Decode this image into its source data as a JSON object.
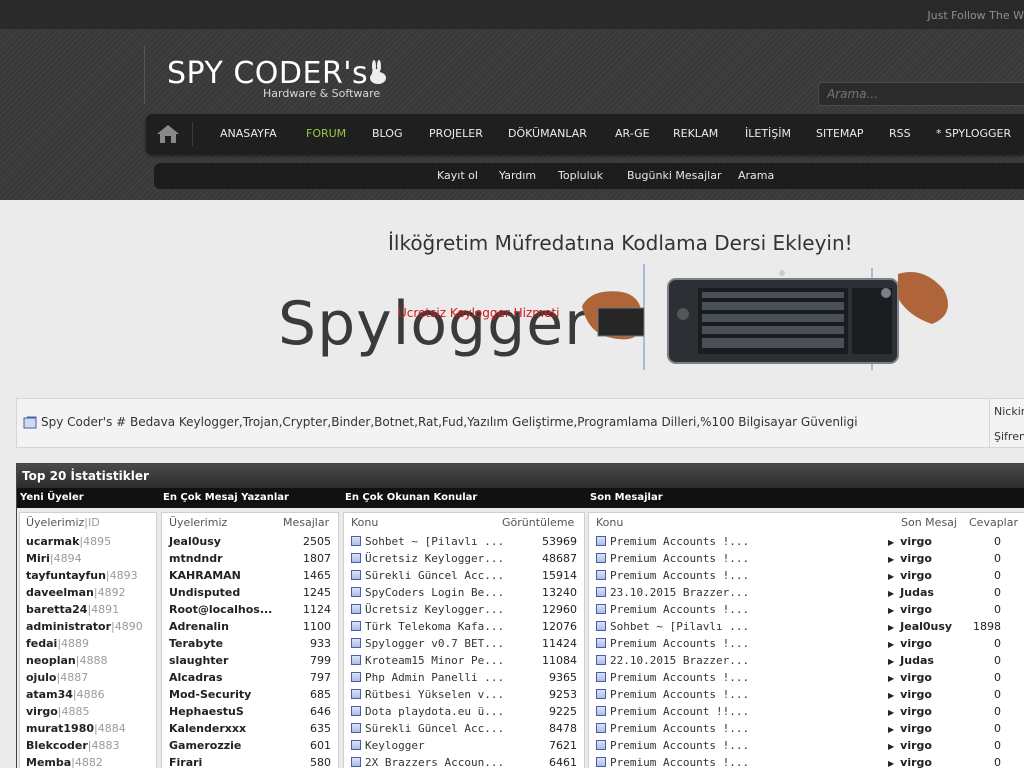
{
  "topbar": {
    "tagline": "Just Follow The W"
  },
  "logo": {
    "title": "SPY CODER's",
    "subtitle": "Hardware & Software"
  },
  "search": {
    "placeholder": "Arama..."
  },
  "nav": [
    {
      "label": "ANASAYFA"
    },
    {
      "label": "FORUM"
    },
    {
      "label": "BLOG"
    },
    {
      "label": "PROJELER"
    },
    {
      "label": "DÖKÜMANLAR"
    },
    {
      "label": "AR-GE"
    },
    {
      "label": "REKLAM"
    },
    {
      "label": "İLETİŞİM"
    },
    {
      "label": "SITEMAP"
    },
    {
      "label": "RSS"
    },
    {
      "label": "* SPYLOGGER"
    }
  ],
  "subnav": [
    {
      "label": "Kayıt ol"
    },
    {
      "label": "Yardım"
    },
    {
      "label": "Topluluk"
    },
    {
      "label": "Bugünki Mesajlar"
    },
    {
      "label": "Arama"
    }
  ],
  "banner": {
    "title": "İlköğretim Müfredatına Kodlama Dersi Ekleyin!",
    "big": "Spylogger",
    "red": "Ücretsiz Keylogger Hizmeti"
  },
  "info": {
    "text": "Spy Coder's # Bedava Keylogger,Trojan,Crypter,Binder,Botnet,Rat,Fud,Yazılım Geliştirme,Programlama Dilleri,%100 Bilgisayar Güvenligi",
    "right1": "Nickin",
    "right2": "Şifren"
  },
  "stats": {
    "title": "Top 20 İstatistikler",
    "col_new": "Yeni Üyeler",
    "col_posters": "En Çok Mesaj Yazanlar",
    "col_read": "En Çok Okunan Konular",
    "col_last": "Son Mesajlar",
    "new_members": {
      "h_name": "Üyelerimiz",
      "h_id": "|ID",
      "rows": [
        {
          "name": "ucarmak",
          "id": "|4895"
        },
        {
          "name": "Miri",
          "id": "|4894"
        },
        {
          "name": "tayfuntayfun",
          "id": "|4893"
        },
        {
          "name": "daveelman",
          "id": "|4892"
        },
        {
          "name": "baretta24",
          "id": "|4891"
        },
        {
          "name": "administrator",
          "id": "|4890"
        },
        {
          "name": "fedai",
          "id": "|4889"
        },
        {
          "name": "neoplan",
          "id": "|4888"
        },
        {
          "name": "ojulo",
          "id": "|4887"
        },
        {
          "name": "atam34",
          "id": "|4886"
        },
        {
          "name": "virgo",
          "id": "|4885"
        },
        {
          "name": "murat1980",
          "id": "|4884"
        },
        {
          "name": "Blekcoder",
          "id": "|4883"
        },
        {
          "name": "Memba",
          "id": "|4882"
        }
      ]
    },
    "posters": {
      "h_name": "Üyelerimiz",
      "h_count": "Mesajlar",
      "rows": [
        {
          "name": "Jeal0usy",
          "count": "2505"
        },
        {
          "name": "mtndndr",
          "count": "1807"
        },
        {
          "name": "KAHRAMAN",
          "count": "1465"
        },
        {
          "name": "Undisputed",
          "count": "1245"
        },
        {
          "name": "Root@localhos...",
          "count": "1124"
        },
        {
          "name": "Adrenalin",
          "count": "1100"
        },
        {
          "name": "Terabyte",
          "count": "933"
        },
        {
          "name": "slaughter",
          "count": "799"
        },
        {
          "name": "Alcadras",
          "count": "797"
        },
        {
          "name": "Mod-Security",
          "count": "685"
        },
        {
          "name": "HephaestuS",
          "count": "646"
        },
        {
          "name": "Kalenderxxx",
          "count": "635"
        },
        {
          "name": "Gamerozzie",
          "count": "601"
        },
        {
          "name": "Firari",
          "count": "580"
        }
      ]
    },
    "most_read": {
      "h_topic": "Konu",
      "h_views": "Görüntüleme",
      "rows": [
        {
          "topic": "Sohbet ~ [Pilavlı ...",
          "views": "53969"
        },
        {
          "topic": "Ücretsiz Keylogger...",
          "views": "48687"
        },
        {
          "topic": "Sürekli Güncel Acc...",
          "views": "15914"
        },
        {
          "topic": "SpyCoders Login Be...",
          "views": "13240"
        },
        {
          "topic": "Ücretsiz Keylogger...",
          "views": "12960"
        },
        {
          "topic": "Türk Telekoma Kafa...",
          "views": "12076"
        },
        {
          "topic": "Spylogger v0.7 BET...",
          "views": "11424"
        },
        {
          "topic": "Kroteam15 Minor Pe...",
          "views": "11084"
        },
        {
          "topic": "Php Admin Panelli ...",
          "views": "9365"
        },
        {
          "topic": "Rütbesi Yükselen v...",
          "views": "9253"
        },
        {
          "topic": "Dota playdota.eu ü...",
          "views": "9225"
        },
        {
          "topic": "Sürekli Güncel Acc...",
          "views": "8478"
        },
        {
          "topic": "Keylogger",
          "views": "7621"
        },
        {
          "topic": "2X Brazzers Accoun...",
          "views": "6461"
        }
      ]
    },
    "last_posts": {
      "h_topic": "Konu",
      "h_last": "Son Mesaj",
      "h_replies": "Cevaplar",
      "rows": [
        {
          "topic": "Premium Accounts !...",
          "user": "virgo",
          "replies": "0"
        },
        {
          "topic": "Premium Accounts !...",
          "user": "virgo",
          "replies": "0"
        },
        {
          "topic": "Premium Accounts !...",
          "user": "virgo",
          "replies": "0"
        },
        {
          "topic": "23.10.2015 Brazzer...",
          "user": "Judas",
          "replies": "0"
        },
        {
          "topic": "Premium Accounts !...",
          "user": "virgo",
          "replies": "0"
        },
        {
          "topic": "Sohbet ~ [Pilavlı ...",
          "user": "Jeal0usy",
          "replies": "1898"
        },
        {
          "topic": "Premium Accounts !...",
          "user": "virgo",
          "replies": "0"
        },
        {
          "topic": "22.10.2015 Brazzer...",
          "user": "Judas",
          "replies": "0"
        },
        {
          "topic": "Premium Accounts !...",
          "user": "virgo",
          "replies": "0"
        },
        {
          "topic": "Premium Accounts !...",
          "user": "virgo",
          "replies": "0"
        },
        {
          "topic": "Premium Account !!...",
          "user": "virgo",
          "replies": "0"
        },
        {
          "topic": "Premium Accounts !...",
          "user": "virgo",
          "replies": "0"
        },
        {
          "topic": "Premium Accounts !...",
          "user": "virgo",
          "replies": "0"
        },
        {
          "topic": "Premium Accounts !...",
          "user": "virgo",
          "replies": "0"
        }
      ]
    }
  }
}
